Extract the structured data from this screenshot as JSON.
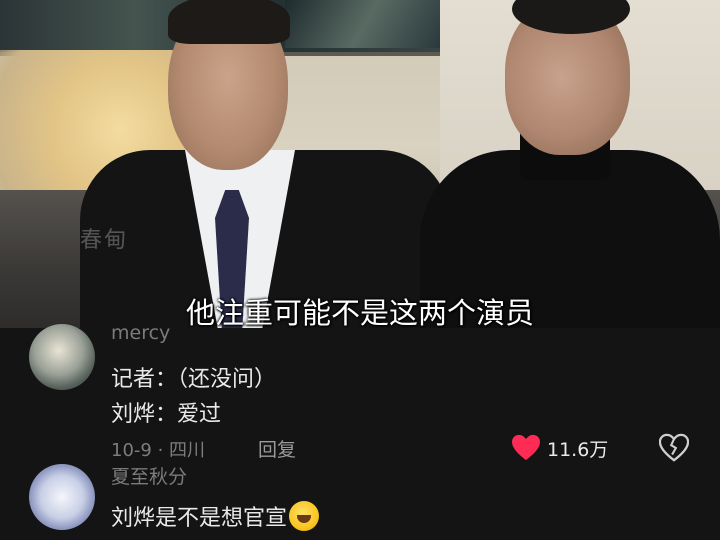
{
  "video": {
    "watermark": "春甸",
    "subtitle": "他注重可能不是这两个演员"
  },
  "comments": [
    {
      "username": "mercy",
      "lines": [
        "记者：（还没问）",
        "刘烨：爱过"
      ],
      "meta": "10-9 · 四川",
      "reply_label": "回复",
      "likes": "11.6万",
      "like_icon": "heart-icon",
      "dislike_icon": "broken-heart-icon",
      "like_color": "#fe2c55"
    },
    {
      "username": "夏至秋分",
      "lines": [
        "刘烨是不是想官宣"
      ],
      "emoji": "rolling-laughing-emoji"
    }
  ]
}
